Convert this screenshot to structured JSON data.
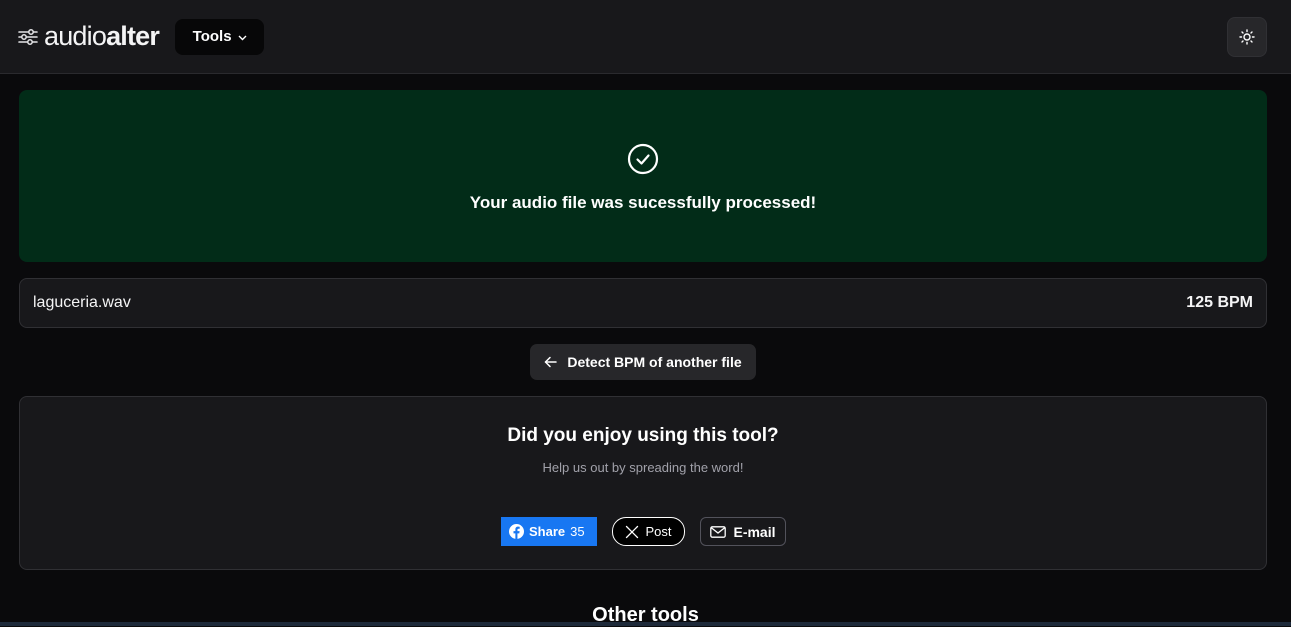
{
  "header": {
    "logo": {
      "light": "audio",
      "bold": "alter"
    },
    "tools_label": "Tools",
    "theme_icon": "sun-icon"
  },
  "success": {
    "icon": "check-circle-icon",
    "message": "Your audio file was sucessfully processed!"
  },
  "result": {
    "filename": "laguceria.wav",
    "bpm": "125 BPM"
  },
  "detect_button": {
    "icon": "arrow-left-icon",
    "label": "Detect BPM of another file"
  },
  "share": {
    "title": "Did you enjoy using this tool?",
    "subtitle": "Help us out by spreading the word!",
    "facebook": {
      "label": "Share",
      "count": "35",
      "color": "#1877f2"
    },
    "x": {
      "label": "Post"
    },
    "email": {
      "label": "E-mail"
    }
  },
  "other_tools": {
    "title": "Other tools"
  },
  "colors": {
    "background": "#0a0a0c",
    "header": "#18181b",
    "success_bg": "#022c18",
    "card": "#18181b"
  }
}
